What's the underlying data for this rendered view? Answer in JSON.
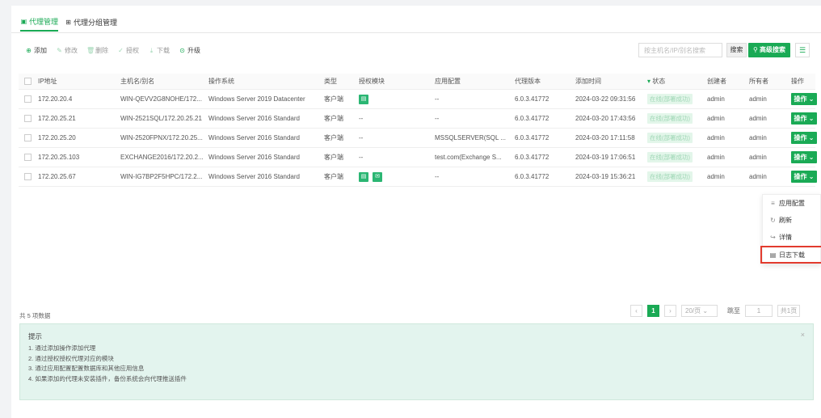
{
  "tabs": [
    {
      "label": "代理管理",
      "icon": "agent-icon",
      "active": true
    },
    {
      "label": "代理分组管理",
      "icon": "group-icon",
      "active": false
    }
  ],
  "toolbar": {
    "add": "添加",
    "edit": "修改",
    "delete": "删除",
    "authorize": "授权",
    "download": "下载",
    "upgrade": "升级"
  },
  "search": {
    "placeholder": "按主机名/IP/别名搜索",
    "button": "搜索",
    "advanced": "高级搜索"
  },
  "columns": [
    "IP地址",
    "主机名/别名",
    "操作系统",
    "类型",
    "授权模块",
    "应用配置",
    "代理版本",
    "添加时间",
    "状态",
    "创建者",
    "所有者",
    "操作"
  ],
  "rows": [
    {
      "ip": "172.20.20.4",
      "host": "WIN-QEVV2G8NOHE/172...",
      "os": "Windows Server 2019 Datacenter",
      "type": "客户端",
      "modules": [
        "doc"
      ],
      "app": "--",
      "version": "6.0.3.41772",
      "time": "2024-03-22 09:31:56",
      "status": "在线(部署成功)",
      "creator": "admin",
      "owner": "admin",
      "op": "操作"
    },
    {
      "ip": "172.20.25.21",
      "host": "WIN-2521SQL/172.20.25.21",
      "os": "Windows Server 2016 Standard",
      "type": "客户端",
      "modules": [],
      "modules_text": "--",
      "app": "--",
      "version": "6.0.3.41772",
      "time": "2024-03-20 17:43:56",
      "status": "在线(部署成功)",
      "creator": "admin",
      "owner": "admin",
      "op": "操作"
    },
    {
      "ip": "172.20.25.20",
      "host": "WIN-2520FPNX/172.20.25...",
      "os": "Windows Server 2016 Standard",
      "type": "客户端",
      "modules": [],
      "modules_text": "--",
      "app": "MSSQLSERVER(SQL ...",
      "version": "6.0.3.41772",
      "time": "2024-03-20 17:11:58",
      "status": "在线(部署成功)",
      "creator": "admin",
      "owner": "admin",
      "op": "操作"
    },
    {
      "ip": "172.20.25.103",
      "host": "EXCHANGE2016/172.20.2...",
      "os": "Windows Server 2016 Standard",
      "type": "客户端",
      "modules": [],
      "modules_text": "--",
      "app": "test.com(Exchange S...",
      "version": "6.0.3.41772",
      "time": "2024-03-19 17:06:51",
      "status": "在线(部署成功)",
      "creator": "admin",
      "owner": "admin",
      "op": "操作"
    },
    {
      "ip": "172.20.25.67",
      "host": "WIN-IG7BP2F5HPC/172.2...",
      "os": "Windows Server 2016 Standard",
      "type": "客户端",
      "modules": [
        "doc",
        "mail"
      ],
      "app": "--",
      "version": "6.0.3.41772",
      "time": "2024-03-19 15:36:21",
      "status": "在线(部署成功)",
      "creator": "admin",
      "owner": "admin",
      "op": "操作"
    }
  ],
  "dropdown_menu": [
    {
      "label": "应用配置",
      "icon": "list-icon"
    },
    {
      "label": "刷新",
      "icon": "refresh-icon"
    },
    {
      "label": "详情",
      "icon": "share-arrow-icon"
    },
    {
      "label": "日志下载",
      "icon": "file-icon",
      "highlighted": true
    }
  ],
  "footer": {
    "total": "共 5 项数据",
    "page": "1",
    "page_size": "20/页",
    "jump_label": "跳至",
    "jump_value": "1",
    "total_pages": "共1页"
  },
  "tips": {
    "title": "提示",
    "lines": [
      "1. 通过添加操作添加代理",
      "2. 通过授权授权代理对应的模块",
      "3. 通过应用配置配置数据库和其他应用信息",
      "4. 如果添加的代理未安装插件，备份系统会向代理推送插件"
    ]
  },
  "colors": {
    "accent": "#1aaa55",
    "status_bg": "#e3f6ea",
    "tip_bg": "#e3f4ee",
    "highlight_border": "#e23b2e"
  }
}
